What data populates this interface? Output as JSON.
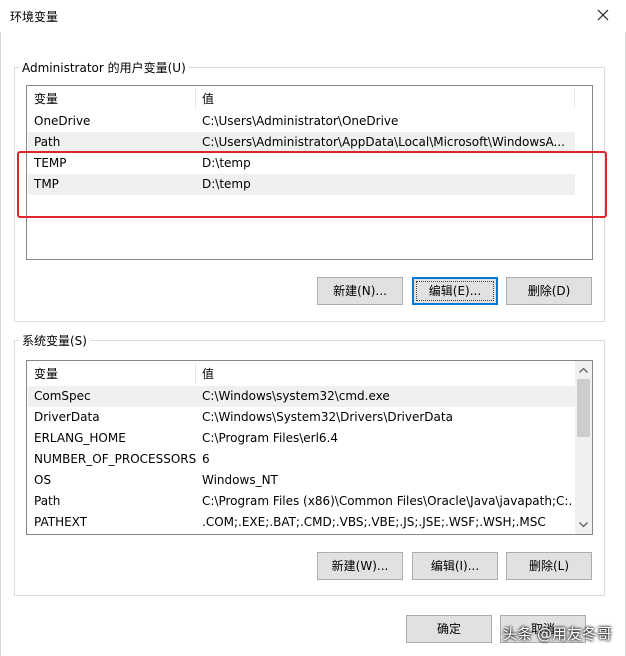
{
  "window": {
    "title": "环境变量"
  },
  "user_group": {
    "label": "Administrator 的用户变量(U)",
    "columns": [
      "变量",
      "值"
    ],
    "rows": [
      {
        "name": "OneDrive",
        "value": "C:\\Users\\Administrator\\OneDrive"
      },
      {
        "name": "Path",
        "value": "C:\\Users\\Administrator\\AppData\\Local\\Microsoft\\WindowsA..."
      },
      {
        "name": "TEMP",
        "value": "D:\\temp"
      },
      {
        "name": "TMP",
        "value": "D:\\temp"
      }
    ],
    "buttons": {
      "new": "新建(N)...",
      "edit": "编辑(E)...",
      "delete": "删除(D)"
    }
  },
  "system_group": {
    "label": "系统变量(S)",
    "columns": [
      "变量",
      "值"
    ],
    "rows": [
      {
        "name": "ComSpec",
        "value": "C:\\Windows\\system32\\cmd.exe"
      },
      {
        "name": "DriverData",
        "value": "C:\\Windows\\System32\\Drivers\\DriverData"
      },
      {
        "name": "ERLANG_HOME",
        "value": "C:\\Program Files\\erl6.4"
      },
      {
        "name": "NUMBER_OF_PROCESSORS",
        "value": "6"
      },
      {
        "name": "OS",
        "value": "Windows_NT"
      },
      {
        "name": "Path",
        "value": "C:\\Program Files (x86)\\Common Files\\Oracle\\Java\\javapath;C:..."
      },
      {
        "name": "PATHEXT",
        "value": ".COM;.EXE;.BAT;.CMD;.VBS;.VBE;.JS;.JSE;.WSF;.WSH;.MSC"
      }
    ],
    "buttons": {
      "new": "新建(W)...",
      "edit": "编辑(I)...",
      "delete": "删除(L)"
    }
  },
  "footer": {
    "ok": "确定",
    "cancel": "取消"
  },
  "watermark": "头条 @用友冬哥",
  "colors": {
    "highlight": "#e0262b",
    "focus": "#0078d7"
  }
}
